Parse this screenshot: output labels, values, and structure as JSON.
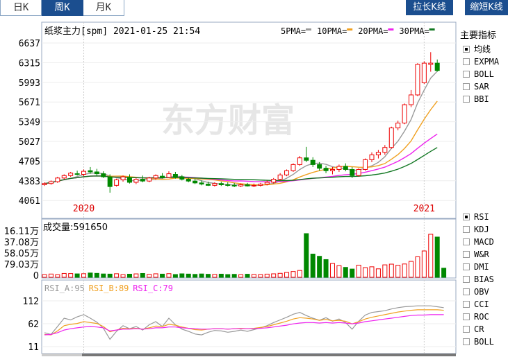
{
  "tabs": [
    {
      "label": "日K",
      "active": false
    },
    {
      "label": "周K",
      "active": true
    },
    {
      "label": "月K",
      "active": false
    }
  ],
  "buttons": {
    "stretch": "拉长K线",
    "shrink": "缩短K线"
  },
  "kline": {
    "title": "纸浆主力[spm] 2021-01-25 21:54",
    "ma_legend": [
      {
        "label": "5PMA=",
        "color": "#999999"
      },
      {
        "label": "10PMA=",
        "color": "#f0a020"
      },
      {
        "label": "20PMA=",
        "color": "#ee22ee"
      },
      {
        "label": "30PMA=",
        "color": "#117722"
      }
    ],
    "watermark": "东方财富"
  },
  "volume": {
    "title": "成交量:591650"
  },
  "rsi": {
    "labels": [
      {
        "text": "RSI_A:95",
        "color": "#999999"
      },
      {
        "text": "RSI_B:89",
        "color": "#f0a020"
      },
      {
        "text": "RSI_C:79",
        "color": "#ee22ee"
      }
    ]
  },
  "sidebar": {
    "title": "主要指标",
    "main_indicators": [
      {
        "label": "均线",
        "checked": true
      },
      {
        "label": "EXPMA",
        "checked": false
      },
      {
        "label": "BOLL",
        "checked": false
      },
      {
        "label": "SAR",
        "checked": false
      },
      {
        "label": "BBI",
        "checked": false
      }
    ],
    "sub_indicators": [
      {
        "label": "RSI",
        "checked": true
      },
      {
        "label": "KDJ",
        "checked": false
      },
      {
        "label": "MACD",
        "checked": false
      },
      {
        "label": "W&R",
        "checked": false
      },
      {
        "label": "DMI",
        "checked": false
      },
      {
        "label": "BIAS",
        "checked": false
      },
      {
        "label": "OBV",
        "checked": false
      },
      {
        "label": "CCI",
        "checked": false
      },
      {
        "label": "ROC",
        "checked": false
      },
      {
        "label": "CR",
        "checked": false
      },
      {
        "label": "BOLL",
        "checked": false
      }
    ]
  },
  "chart_data": {
    "type": "candlestick",
    "price_ticks": [
      "6637",
      "6315",
      "5993",
      "5671",
      "5349",
      "5027",
      "4705",
      "4383",
      "4061"
    ],
    "price_range": [
      4061,
      6637
    ],
    "year_labels": [
      {
        "text": "2020",
        "index": 6
      },
      {
        "text": "2021",
        "index": 58
      }
    ],
    "volume_ticks": [
      "16.11万",
      "37.08万",
      "58.05万",
      "79.03万",
      "0"
    ],
    "volume_max": 161100,
    "rsi_ticks": [
      "112",
      "62",
      "11"
    ],
    "rsi_range": [
      11,
      112
    ],
    "ohlc": [
      [
        4430,
        4470,
        4410,
        4450
      ],
      [
        4450,
        4500,
        4430,
        4480
      ],
      [
        4480,
        4560,
        4460,
        4540
      ],
      [
        4540,
        4600,
        4520,
        4580
      ],
      [
        4580,
        4640,
        4560,
        4620
      ],
      [
        4610,
        4660,
        4580,
        4600
      ],
      [
        4600,
        4680,
        4570,
        4650
      ],
      [
        4660,
        4720,
        4610,
        4640
      ],
      [
        4640,
        4690,
        4580,
        4610
      ],
      [
        4610,
        4650,
        4540,
        4560
      ],
      [
        4560,
        4600,
        4300,
        4400
      ],
      [
        4420,
        4530,
        4400,
        4510
      ],
      [
        4510,
        4580,
        4480,
        4560
      ],
      [
        4550,
        4600,
        4450,
        4470
      ],
      [
        4470,
        4540,
        4440,
        4520
      ],
      [
        4520,
        4580,
        4470,
        4490
      ],
      [
        4490,
        4560,
        4470,
        4540
      ],
      [
        4540,
        4600,
        4510,
        4580
      ],
      [
        4570,
        4620,
        4530,
        4550
      ],
      [
        4550,
        4650,
        4540,
        4610
      ],
      [
        4600,
        4640,
        4530,
        4560
      ],
      [
        4560,
        4590,
        4500,
        4520
      ],
      [
        4520,
        4550,
        4470,
        4490
      ],
      [
        4490,
        4530,
        4440,
        4460
      ],
      [
        4460,
        4500,
        4420,
        4440
      ],
      [
        4440,
        4480,
        4410,
        4420
      ],
      [
        4420,
        4470,
        4400,
        4450
      ],
      [
        4450,
        4480,
        4410,
        4430
      ],
      [
        4430,
        4470,
        4400,
        4420
      ],
      [
        4420,
        4460,
        4390,
        4410
      ],
      [
        4410,
        4450,
        4390,
        4430
      ],
      [
        4430,
        4460,
        4400,
        4410
      ],
      [
        4410,
        4450,
        4390,
        4420
      ],
      [
        4420,
        4460,
        4400,
        4440
      ],
      [
        4440,
        4500,
        4420,
        4470
      ],
      [
        4470,
        4540,
        4450,
        4520
      ],
      [
        4520,
        4620,
        4500,
        4590
      ],
      [
        4590,
        4680,
        4570,
        4660
      ],
      [
        4660,
        4780,
        4640,
        4760
      ],
      [
        4760,
        4900,
        4740,
        4870
      ],
      [
        4870,
        5050,
        4800,
        4830
      ],
      [
        4830,
        4880,
        4720,
        4760
      ],
      [
        4760,
        4800,
        4660,
        4700
      ],
      [
        4700,
        4740,
        4620,
        4660
      ],
      [
        4660,
        4720,
        4600,
        4680
      ],
      [
        4680,
        4760,
        4640,
        4730
      ],
      [
        4730,
        4780,
        4650,
        4680
      ],
      [
        4680,
        4720,
        4540,
        4580
      ],
      [
        4580,
        4700,
        4560,
        4680
      ],
      [
        4680,
        4860,
        4660,
        4840
      ],
      [
        4840,
        4960,
        4800,
        4920
      ],
      [
        4920,
        5000,
        4860,
        4960
      ],
      [
        4960,
        5080,
        4920,
        5040
      ],
      [
        5040,
        5380,
        5020,
        5360
      ],
      [
        5360,
        5480,
        5320,
        5440
      ],
      [
        5440,
        5760,
        5420,
        5740
      ],
      [
        5740,
        5980,
        5700,
        5900
      ],
      [
        5900,
        6420,
        5880,
        6400
      ],
      [
        6100,
        6450,
        6080,
        6420
      ],
      [
        6400,
        6600,
        6280,
        6420
      ],
      [
        6420,
        6480,
        6280,
        6300
      ]
    ],
    "volume": [
      9800,
      12000,
      9500,
      14200,
      13800,
      12600,
      13200,
      15800,
      14500,
      12300,
      11800,
      13100,
      9800,
      11500,
      12600,
      14100,
      10800,
      12900,
      11700,
      13400,
      10200,
      12800,
      11900,
      10700,
      12300,
      11100,
      10400,
      11600,
      10100,
      10900,
      9700,
      11300,
      10500,
      9900,
      11700,
      12800,
      14600,
      17800,
      21300,
      25200,
      161100,
      85600,
      77400,
      65300,
      50900,
      42800,
      36500,
      30400,
      44800,
      35600,
      38700,
      31200,
      45800,
      48500,
      44300,
      49100,
      58700,
      75600,
      97100,
      158700,
      148400,
      33500
    ],
    "rsi_a": [
      38,
      34,
      52,
      71,
      67,
      74,
      79,
      71,
      62,
      48,
      23,
      41,
      54,
      47,
      52,
      44,
      56,
      63,
      52,
      71,
      56,
      46,
      41,
      35,
      33,
      39,
      43,
      42,
      39,
      41,
      44,
      41,
      45,
      49,
      54,
      61,
      67,
      73,
      80,
      84,
      77,
      71,
      66,
      72,
      64,
      69,
      61,
      46,
      64,
      78,
      84,
      86,
      88,
      92,
      95,
      97,
      98,
      99,
      99,
      99,
      97,
      95
    ],
    "rsi_b": [
      34,
      33,
      42,
      54,
      57,
      59,
      63,
      61,
      59,
      52,
      40,
      44,
      48,
      47,
      48,
      46,
      49,
      53,
      52,
      57,
      55,
      51,
      48,
      45,
      44,
      46,
      47,
      47,
      46,
      47,
      48,
      47,
      48,
      50,
      52,
      56,
      60,
      64,
      69,
      72,
      71,
      69,
      66,
      68,
      65,
      66,
      64,
      58,
      63,
      69,
      73,
      76,
      79,
      82,
      85,
      87,
      89,
      90,
      90,
      90,
      90,
      89
    ],
    "rsi_c": [
      33,
      34,
      38,
      44,
      47,
      49,
      51,
      52,
      51,
      49,
      42,
      44,
      46,
      46,
      47,
      46,
      47,
      49,
      49,
      51,
      51,
      49,
      48,
      47,
      46,
      46,
      47,
      47,
      46,
      47,
      47,
      47,
      47,
      48,
      49,
      51,
      53,
      55,
      58,
      60,
      61,
      61,
      60,
      61,
      60,
      61,
      60,
      58,
      60,
      63,
      65,
      67,
      69,
      71,
      73,
      75,
      77,
      78,
      78,
      79,
      79,
      79
    ]
  }
}
